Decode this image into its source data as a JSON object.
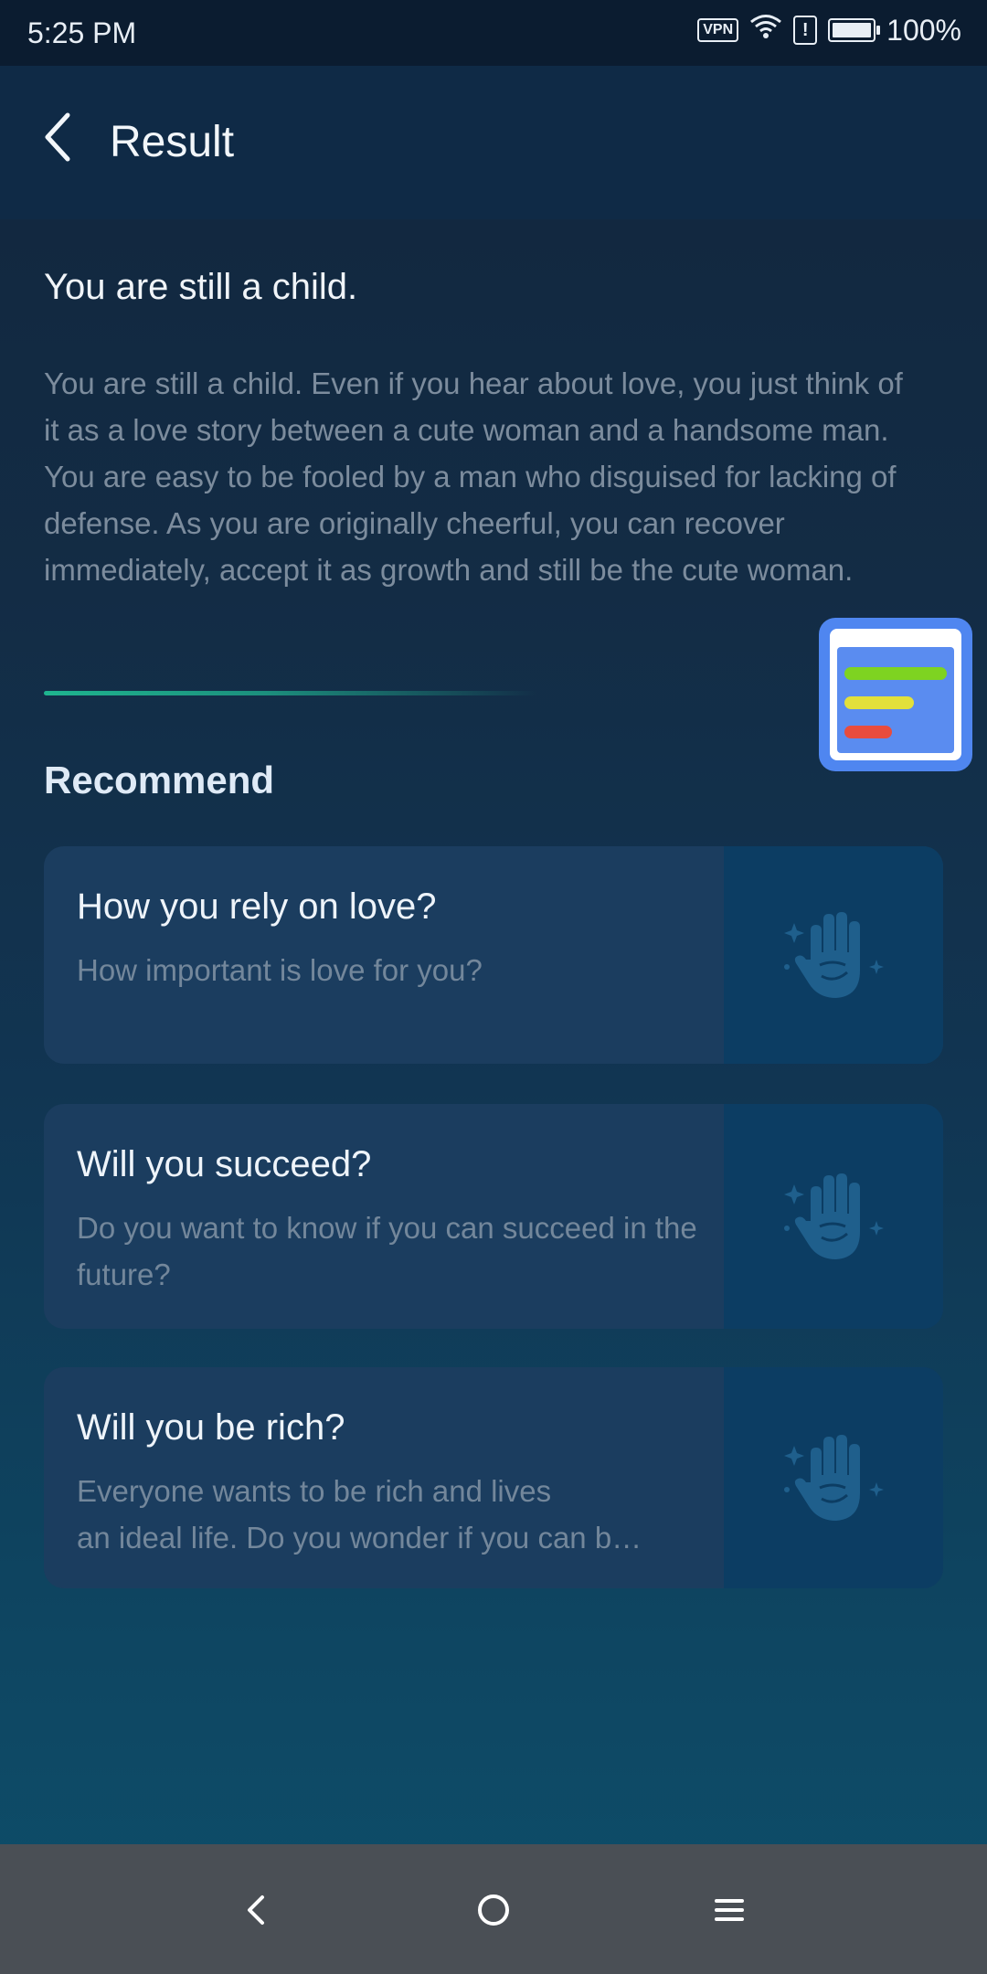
{
  "status_bar": {
    "time": "5:25 PM",
    "vpn_label": "VPN",
    "alert_label": "!",
    "battery_text": "100%",
    "battery_level": 1.0,
    "icons": [
      "vpn-icon",
      "wifi-icon",
      "alert-icon",
      "battery-icon"
    ]
  },
  "app_bar": {
    "title": "Result",
    "back_icon": "chevron-left-icon"
  },
  "result": {
    "title": "You are still a child.",
    "description": "You are still a child. Even if you hear about love, you just think of it as a love story between a cute woman and a handsome man. You are easy to be fooled by a man who disguised for lacking of defense. As you are originally cheerful, you can recover immediately, accept it as growth and still be the cute woman."
  },
  "recommend": {
    "section_title": "Recommend",
    "items": [
      {
        "title": "How you rely on love?",
        "description": "How important is love for you?",
        "icon": "palm-icon"
      },
      {
        "title": "Will you succeed?",
        "description": "Do you want to know if you can succeed in the future?",
        "icon": "palm-icon"
      },
      {
        "title": "Will you be rich?",
        "description_line1": "Everyone wants to be rich and lives",
        "description_line2": "an ideal life. Do you wonder if you can b…",
        "icon": "palm-icon"
      }
    ]
  },
  "floating_widget": {
    "icon": "floating-notes-icon",
    "colors": [
      "#5a8cf0",
      "#7ed321",
      "#e2e03b",
      "#e84c3d"
    ]
  },
  "nav_bar": {
    "icons": [
      "nav-back-icon",
      "nav-home-icon",
      "nav-menu-icon"
    ]
  },
  "colors": {
    "accent_divider": "#1fb58f",
    "card_bg": "#1b3d5f",
    "card_media_bg": "#0c3d63"
  }
}
